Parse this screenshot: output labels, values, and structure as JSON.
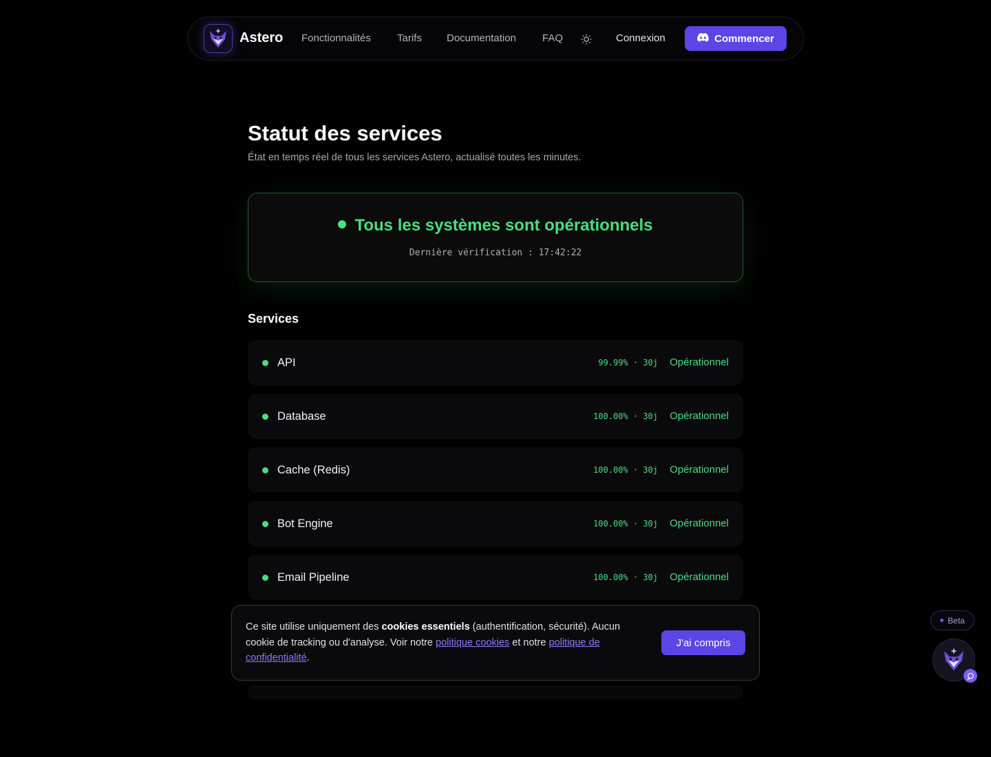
{
  "nav": {
    "brand": "Astero",
    "links": [
      "Fonctionnalités",
      "Tarifs",
      "Documentation",
      "FAQ"
    ],
    "login": "Connexion",
    "cta": "Commencer"
  },
  "header": {
    "title": "Statut des services",
    "subtitle": "État en temps réel de tous les services Astero, actualisé toutes les minutes."
  },
  "status": {
    "headline": "Tous les systèmes sont opérationnels",
    "last_check": "Dernière vérification : 17:42:22"
  },
  "services_heading": "Services",
  "services": [
    {
      "name": "API",
      "uptime": "99.99% · 30j",
      "state": "Opérationnel"
    },
    {
      "name": "Database",
      "uptime": "100.00% · 30j",
      "state": "Opérationnel"
    },
    {
      "name": "Cache (Redis)",
      "uptime": "100.00% · 30j",
      "state": "Opérationnel"
    },
    {
      "name": "Bot Engine",
      "uptime": "100.00% · 30j",
      "state": "Opérationnel"
    },
    {
      "name": "Email Pipeline",
      "uptime": "100.00% · 30j",
      "state": "Opérationnel"
    }
  ],
  "cookie": {
    "text_1": "Ce site utilise uniquement des ",
    "bold": "cookies essentiels",
    "text_2": " (authentification, sécurité). Aucun cookie de tracking ou d'analyse. Voir notre ",
    "link_1": "politique cookies",
    "text_3": " et notre ",
    "link_2": "politique de confidentialité",
    "text_4": ".",
    "button": "J'ai compris"
  },
  "beta_label": "Beta",
  "colors": {
    "accent": "#5a46e4",
    "ok": "#4ade80",
    "link": "#8b7bff"
  },
  "icons": [
    "fox-logo-icon",
    "sun-icon",
    "discord-icon",
    "chat-icon"
  ]
}
